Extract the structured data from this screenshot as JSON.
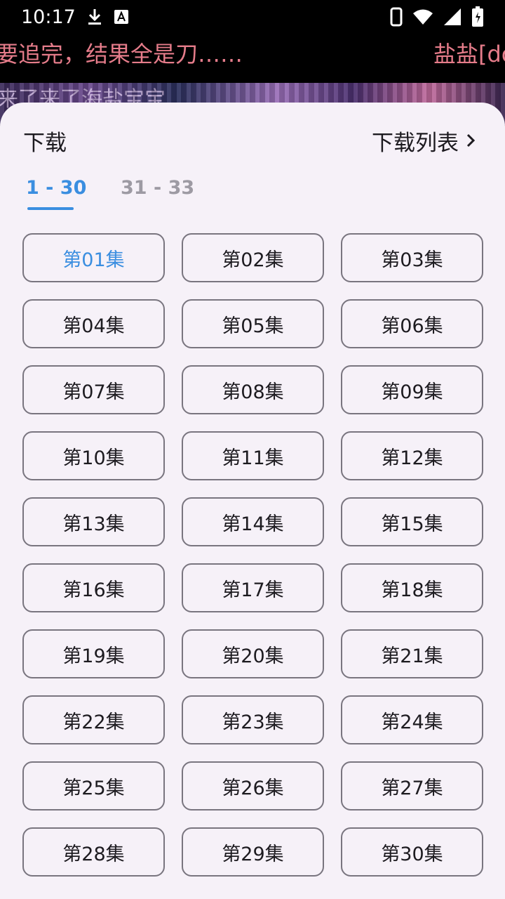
{
  "status_bar": {
    "time": "10:17",
    "icons": [
      "download-icon",
      "keyboard-a-icon",
      "phone-icon",
      "wifi-icon",
      "signal-icon",
      "battery-icon"
    ]
  },
  "danmaku": {
    "line1": "要追完，结果全是刀……",
    "line2": "盐盐[do",
    "caption": "来了来了海盐宝宝"
  },
  "sheet": {
    "title": "下载",
    "download_list_label": "下载列表",
    "tabs": [
      {
        "label": "1 - 30",
        "active": true
      },
      {
        "label": "31 - 33",
        "active": false
      }
    ],
    "episodes": [
      "第01集",
      "第02集",
      "第03集",
      "第04集",
      "第05集",
      "第06集",
      "第07集",
      "第08集",
      "第09集",
      "第10集",
      "第11集",
      "第12集",
      "第13集",
      "第14集",
      "第15集",
      "第16集",
      "第17集",
      "第18集",
      "第19集",
      "第20集",
      "第21集",
      "第22集",
      "第23集",
      "第24集",
      "第25集",
      "第26集",
      "第27集",
      "第28集",
      "第29集",
      "第30集"
    ],
    "selected_episode_index": 0
  },
  "colors": {
    "accent": "#3a8ee0",
    "sheet_bg": "#f6f1f8",
    "outline": "#79757f",
    "danmaku": "#e57c8a"
  }
}
